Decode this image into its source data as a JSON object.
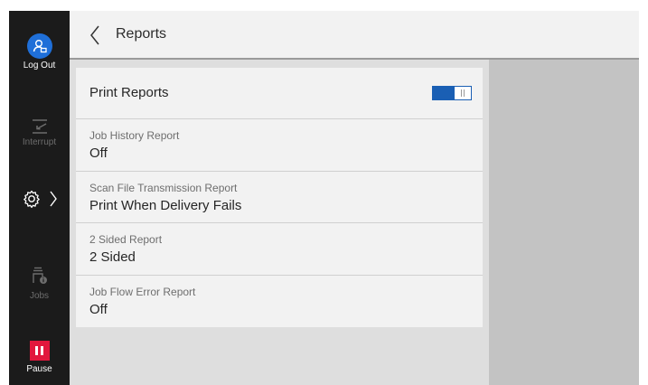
{
  "sidebar": {
    "logout_label": "Log Out",
    "interrupt_label": "Interrupt",
    "jobs_label": "Jobs",
    "pause_label": "Pause"
  },
  "header": {
    "title": "Reports"
  },
  "print_reports": {
    "label": "Print Reports",
    "enabled": true
  },
  "settings": [
    {
      "name": "Job History Report",
      "value": "Off"
    },
    {
      "name": "Scan File Transmission Report",
      "value": "Print When Delivery Fails"
    },
    {
      "name": "2 Sided Report",
      "value": "2 Sided"
    },
    {
      "name": "Job Flow Error Report",
      "value": "Off"
    }
  ],
  "colors": {
    "accent": "#1a5fb4",
    "pause": "#e2173d",
    "rail": "#1b1b1b"
  }
}
